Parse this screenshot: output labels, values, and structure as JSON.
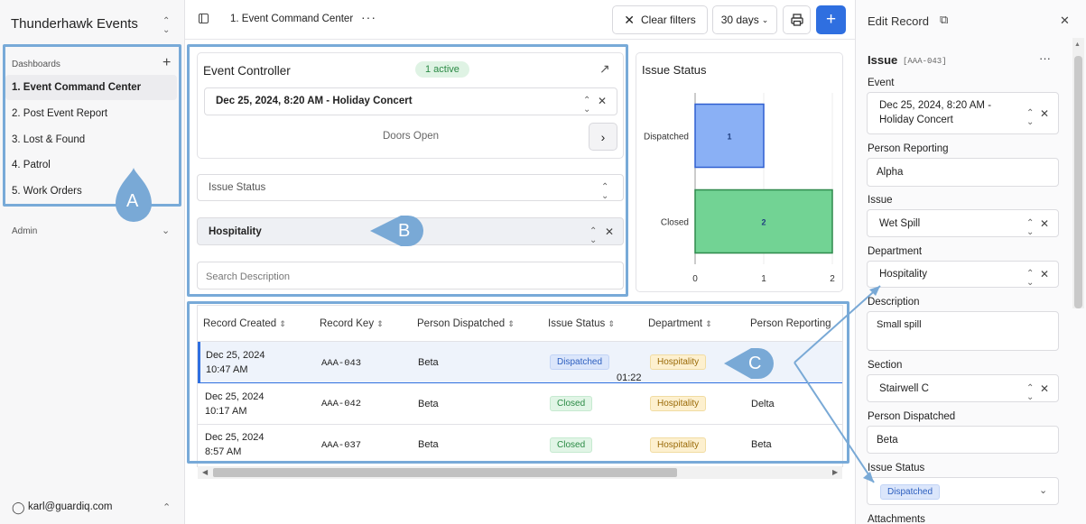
{
  "sidebar": {
    "brand": "Thunderhawk Events",
    "section_dashboards": "Dashboards",
    "items": [
      {
        "label": "1. Event Command Center"
      },
      {
        "label": "2. Post Event Report"
      },
      {
        "label": "3. Lost & Found"
      },
      {
        "label": "4. Patrol"
      },
      {
        "label": "5. Work Orders"
      }
    ],
    "section_admin": "Admin",
    "user": "karl@guardiq.com"
  },
  "topbar": {
    "breadcrumb": "1. Event Command Center",
    "clear_filters": "Clear filters",
    "range": "30 days",
    "add_label": "+"
  },
  "event_controller": {
    "title": "Event Controller",
    "badge": "1 active",
    "event_value": "Dec 25, 2024, 8:20 AM - Holiday Concert",
    "status_text": "Doors Open"
  },
  "filters": {
    "issue_status_placeholder": "Issue Status",
    "department_value": "Hospitality",
    "search_placeholder": "Search Description"
  },
  "chart_data": {
    "type": "bar",
    "orientation": "horizontal",
    "title": "Issue Status",
    "categories": [
      "Dispatched",
      "Closed"
    ],
    "values": [
      1,
      2
    ],
    "colors": [
      "#8ab0f5",
      "#72d394"
    ],
    "xlim": [
      0,
      2
    ],
    "xticks": [
      "0",
      "1",
      "2"
    ]
  },
  "table": {
    "columns": [
      "Record Created",
      "Record Key",
      "Person Dispatched",
      "Issue Status",
      "Department",
      "Person Reporting"
    ],
    "rows": [
      {
        "date": "Dec 25, 2024",
        "time": "10:47 AM",
        "key": "AAA-043",
        "dispatched": "Beta",
        "status": "Dispatched",
        "department": "Hospitality",
        "reporting": ""
      },
      {
        "date": "Dec 25, 2024",
        "time": "10:17 AM",
        "key": "AAA-042",
        "dispatched": "Beta",
        "status": "Closed",
        "department": "Hospitality",
        "reporting": "Delta"
      },
      {
        "date": "Dec 25, 2024",
        "time": "8:57 AM",
        "key": "AAA-037",
        "dispatched": "Beta",
        "status": "Closed",
        "department": "Hospitality",
        "reporting": "Beta"
      }
    ],
    "timer": "01:22"
  },
  "panel": {
    "title": "Edit Record",
    "issue_heading": "Issue",
    "issue_key": "[AAA-043]",
    "event_label": "Event",
    "event_value_l1": "Dec 25, 2024, 8:20 AM -",
    "event_value_l2": "Holiday Concert",
    "person_reporting_label": "Person Reporting",
    "person_reporting_value": "Alpha",
    "issue_label": "Issue",
    "issue_value": "Wet Spill",
    "department_label": "Department",
    "department_value": "Hospitality",
    "description_label": "Description",
    "description_value": "Small spill",
    "section_label": "Section",
    "section_value": "Stairwell C",
    "person_dispatched_label": "Person Dispatched",
    "person_dispatched_value": "Beta",
    "issue_status_label": "Issue Status",
    "issue_status_value": "Dispatched",
    "attachments_label": "Attachments"
  },
  "callouts": {
    "a": "A",
    "b": "B",
    "c": "C"
  }
}
